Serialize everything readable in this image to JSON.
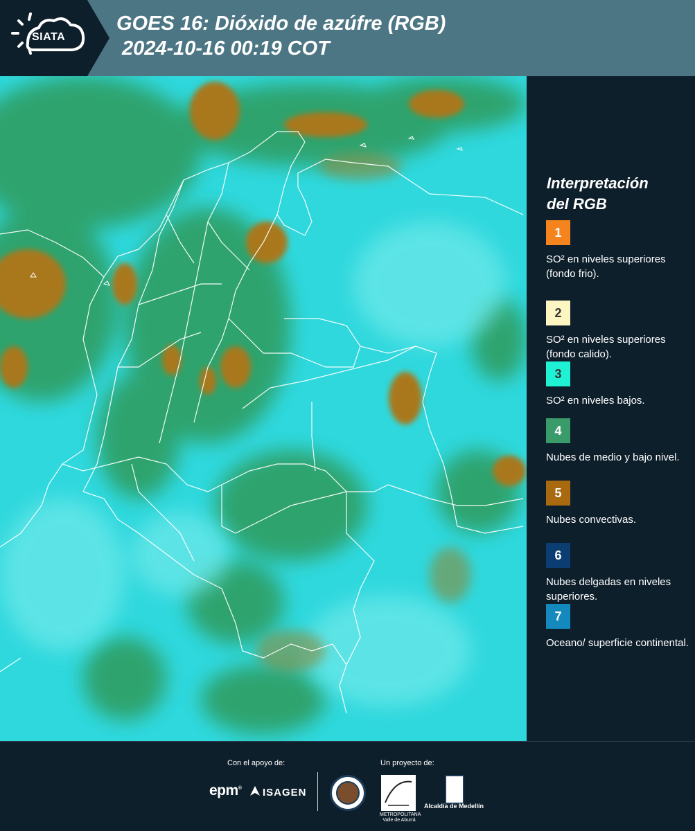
{
  "header": {
    "logo": "SIATA",
    "title_line1": "GOES 16: Dióxido de azúfre (RGB)",
    "title_line2": "2024-10-16 00:19 COT"
  },
  "legend": {
    "title_line1": "Interpretación",
    "title_line2": "del RGB",
    "items": [
      {
        "number": "1",
        "color": "#f5841f",
        "text_color": "#ffffff",
        "text": "SO² en niveles superiores (fondo frio)."
      },
      {
        "number": "2",
        "color": "#fdf6c3",
        "text_color": "#333333",
        "text": "SO² en niveles superiores (fondo calido)."
      },
      {
        "number": "3",
        "color": "#1ff2d4",
        "text_color": "#333333",
        "text": "SO² en niveles bajos."
      },
      {
        "number": "4",
        "color": "#3a9b6a",
        "text_color": "#ffffff",
        "text": "Nubes de medio y bajo nivel."
      },
      {
        "number": "5",
        "color": "#a9690f",
        "text_color": "#ffffff",
        "text": "Nubes convectivas."
      },
      {
        "number": "6",
        "color": "#0c3d72",
        "text_color": "#ffffff",
        "text": "Nubes delgadas en niveles superiores."
      },
      {
        "number": "7",
        "color": "#1489bd",
        "text_color": "#ffffff",
        "text": "Oceano/ superficie continental."
      }
    ]
  },
  "footer": {
    "support_label": "Con el apoyo de:",
    "project_label": "Un proyecto de:",
    "epm": "epm",
    "isagen": "ISAGEN",
    "area_caption": "METROPOLITANA Valle de Aburrá",
    "alcaldia": "Alcaldía de Medellín"
  }
}
